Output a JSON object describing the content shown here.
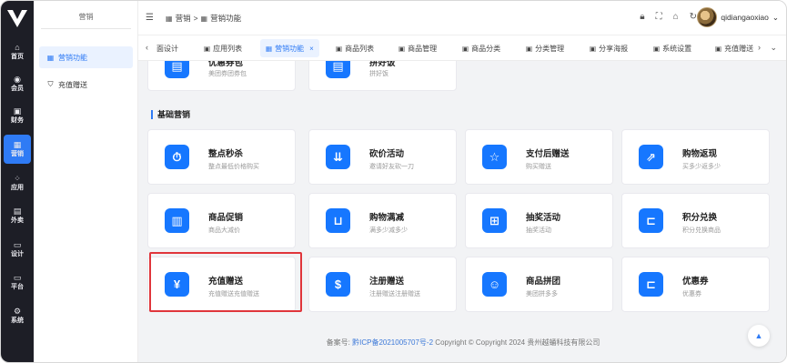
{
  "sidebar": {
    "items": [
      {
        "label": "首页",
        "icon": "home-icon",
        "glyph": "⌂"
      },
      {
        "label": "会员",
        "icon": "member-icon",
        "glyph": "◉"
      },
      {
        "label": "财务",
        "icon": "finance-icon",
        "glyph": "▣"
      },
      {
        "label": "营销",
        "icon": "marketing-icon",
        "glyph": "▦",
        "active": true
      },
      {
        "label": "应用",
        "icon": "apps-icon",
        "glyph": "⁘"
      },
      {
        "label": "外卖",
        "icon": "delivery-icon",
        "glyph": "▤"
      },
      {
        "label": "设计",
        "icon": "design-icon",
        "glyph": "▭"
      },
      {
        "label": "平台",
        "icon": "platform-icon",
        "glyph": "▭"
      },
      {
        "label": "系统",
        "icon": "system-icon",
        "glyph": "⚙"
      }
    ]
  },
  "subside": {
    "title": "营销",
    "items": [
      {
        "label": "营销功能",
        "glyph": "▦",
        "active": true
      },
      {
        "label": "充值赠送",
        "glyph": "⛉",
        "active": false
      }
    ]
  },
  "header": {
    "breadcrumb": [
      "营销",
      ">",
      "营销功能"
    ],
    "username": "qidiangaoxiao",
    "chevron": "⌄"
  },
  "tabs": [
    {
      "label": "面设计"
    },
    {
      "label": "应用列表"
    },
    {
      "label": "营销功能",
      "active": true
    },
    {
      "label": "商品列表"
    },
    {
      "label": "商品管理"
    },
    {
      "label": "商品分类"
    },
    {
      "label": "分类管理"
    },
    {
      "label": "分享海报"
    },
    {
      "label": "系统设置"
    },
    {
      "label": "充值赠送"
    }
  ],
  "top_partial_cards": [
    {
      "title": "优惠券包",
      "desc": "美团券团券包"
    },
    {
      "title": "拼好饭",
      "desc": "拼好饭"
    }
  ],
  "section": {
    "title": "基础营销"
  },
  "cards": [
    {
      "title": "整点秒杀",
      "desc": "整点最低价格购买",
      "glyph": "⏱",
      "icon": "stopwatch-icon"
    },
    {
      "title": "砍价活动",
      "desc": "邀请好友砍一刀",
      "glyph": "⇊",
      "icon": "bargain-icon"
    },
    {
      "title": "支付后赠送",
      "desc": "购买赠送",
      "glyph": "☆",
      "icon": "star-icon"
    },
    {
      "title": "购物返现",
      "desc": "买多少返多少",
      "glyph": "⇗",
      "icon": "cashback-icon"
    },
    {
      "title": "商品促销",
      "desc": "商品大减价",
      "glyph": "▥",
      "icon": "promotion-icon"
    },
    {
      "title": "购物满减",
      "desc": "满多少减多少",
      "glyph": "⊔",
      "icon": "cart-icon"
    },
    {
      "title": "抽奖活动",
      "desc": "抽奖活动",
      "glyph": "⊞",
      "icon": "lottery-icon"
    },
    {
      "title": "积分兑换",
      "desc": "积分兑换商品",
      "glyph": "⊏",
      "icon": "points-icon"
    },
    {
      "title": "充值赠送",
      "desc": "充值赠送充值赠送",
      "glyph": "¥",
      "icon": "yen-icon"
    },
    {
      "title": "注册赠送",
      "desc": "注册赠送注册赠送",
      "glyph": "$",
      "icon": "register-gift-icon"
    },
    {
      "title": "商品拼团",
      "desc": "美团拼多多",
      "glyph": "☺",
      "icon": "group-buy-icon"
    },
    {
      "title": "优惠券",
      "desc": "优惠券",
      "glyph": "⊏",
      "icon": "coupon-icon"
    }
  ],
  "footer": {
    "prefix": "备案号:",
    "icp": "黔ICP备2021005707号-2",
    "copyright": "Copyright ©  Copyright 2024 贵州越蛹科技有限公司"
  },
  "colors": {
    "accent": "#2f7bf5",
    "sidebar_bg": "#1d1e26",
    "card_icon": "#1677ff",
    "highlight": "#e0353b"
  }
}
